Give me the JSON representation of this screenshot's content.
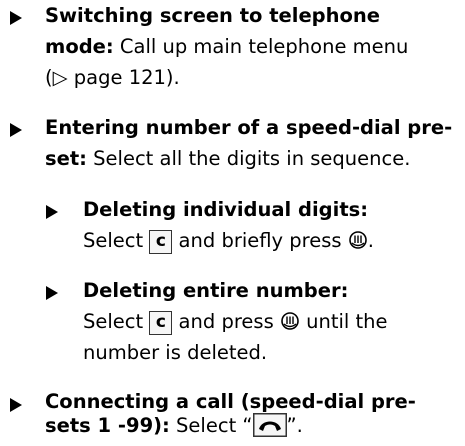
{
  "steps": [
    {
      "title": "Switching screen to telephone",
      "title2": "mode:",
      "body2": " Call up main telephone menu",
      "ref_symbol": "(▷ page 121)",
      "ref_end": "."
    },
    {
      "title": "Entering number of a speed-dial pre-",
      "title2": "set:",
      "body2": " Select all the digits in sequence."
    },
    {
      "title": "Deleting individual digits:",
      "body_a": "Select ",
      "key": "c",
      "body_b": " and briefly press ",
      "body_end": "."
    },
    {
      "title": "Deleting entire number:",
      "body_a": "Select ",
      "key": "c",
      "body_b": " and press ",
      "body_c": " until the",
      "body2": "number is deleted."
    },
    {
      "title": "Connecting a call (speed-dial pre-",
      "title2": "sets 1 -99):",
      "body_a": " Select “",
      "body_b": "”."
    }
  ],
  "icons": {
    "bullet": "triangle-arrow-icon",
    "knob": "rotary-press-knob-icon",
    "phone": "telephone-handset-icon"
  }
}
